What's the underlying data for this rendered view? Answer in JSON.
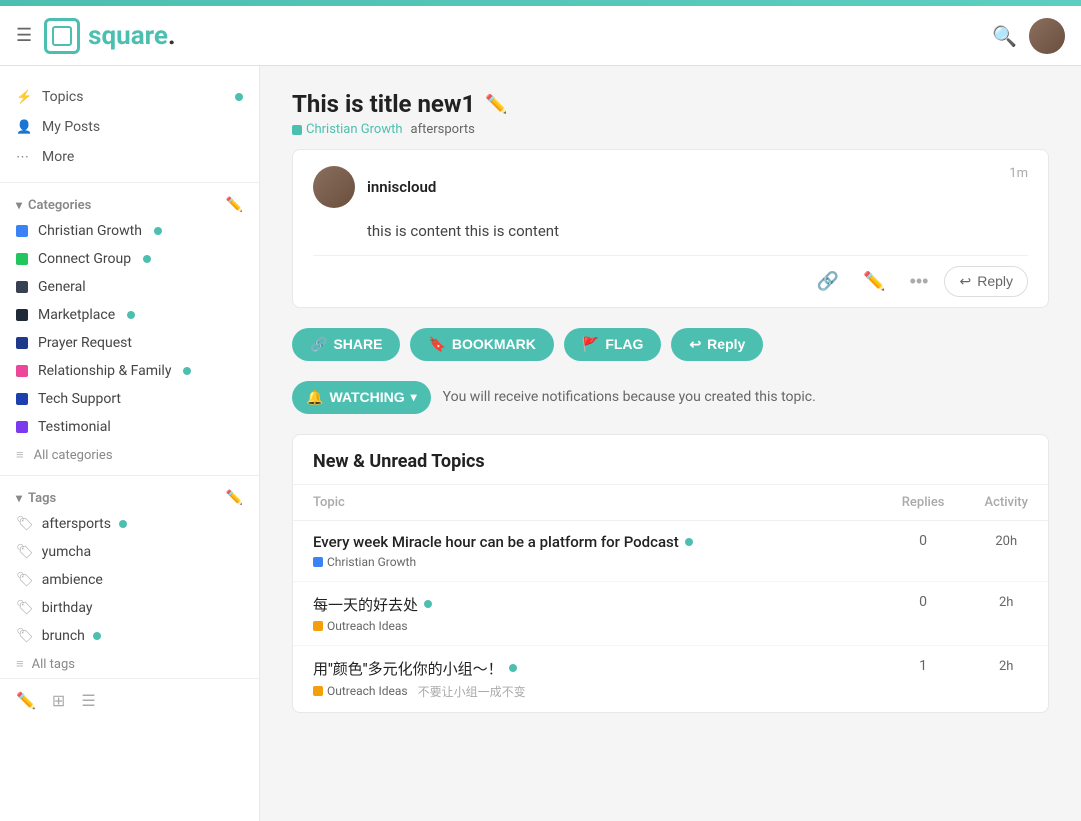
{
  "header": {
    "logo_text": "square",
    "logo_dot": "."
  },
  "sidebar": {
    "nav_items": [
      {
        "label": "Topics",
        "icon": "⋮⋮",
        "has_dot": true
      },
      {
        "label": "My Posts",
        "icon": "👤",
        "has_dot": false
      },
      {
        "label": "More",
        "icon": "⋮⋮⋮",
        "has_dot": false
      }
    ],
    "categories_label": "Categories",
    "categories": [
      {
        "label": "Christian Growth",
        "color": "#3b82f6",
        "has_badge": true
      },
      {
        "label": "Connect Group",
        "color": "#22c55e",
        "has_badge": true
      },
      {
        "label": "General",
        "color": "#374151",
        "has_badge": false
      },
      {
        "label": "Marketplace",
        "color": "#1f2937",
        "has_badge": true
      },
      {
        "label": "Prayer Request",
        "color": "#1e3a8a",
        "has_badge": false
      },
      {
        "label": "Relationship & Family",
        "color": "#ec4899",
        "has_badge": true
      },
      {
        "label": "Tech Support",
        "color": "#1e40af",
        "has_badge": false
      },
      {
        "label": "Testimonial",
        "color": "#7c3aed",
        "has_badge": false
      }
    ],
    "all_categories_label": "All categories",
    "tags_label": "Tags",
    "tags": [
      {
        "label": "aftersports",
        "has_dot": true
      },
      {
        "label": "yumcha",
        "has_dot": false
      },
      {
        "label": "ambience",
        "has_dot": false
      },
      {
        "label": "birthday",
        "has_dot": false
      },
      {
        "label": "brunch",
        "has_dot": true
      }
    ],
    "all_tags_label": "All tags"
  },
  "post": {
    "title": "This is title new1",
    "category": "Christian Growth",
    "tag": "aftersports",
    "author": "inniscloud",
    "time": "1m",
    "content": "this is content this is content",
    "reply_label": "Reply"
  },
  "action_bar": {
    "share_label": "SHARE",
    "bookmark_label": "BOOKMARK",
    "flag_label": "FLAG",
    "reply_label": "Reply",
    "watching_label": "WATCHING",
    "watching_notice": "You will receive notifications because you created this topic."
  },
  "unread_section": {
    "title": "New & Unread Topics",
    "col_topic": "Topic",
    "col_replies": "Replies",
    "col_activity": "Activity",
    "topics": [
      {
        "title": "Every week Miracle hour can be a platform for Podcast",
        "category": "Christian Growth",
        "category_color": "#3b82f6",
        "has_dot": true,
        "replies": 0,
        "activity": "20h",
        "tags": []
      },
      {
        "title": "每一天的好去处",
        "category": "Outreach Ideas",
        "category_color": "#f59e0b",
        "has_dot": true,
        "replies": 0,
        "activity": "2h",
        "tags": []
      },
      {
        "title": "用\"颜色\"多元化你的小组～！",
        "category": "Outreach Ideas",
        "category_color": "#f59e0b",
        "has_dot": true,
        "replies": 1,
        "activity": "2h",
        "tags": [
          "不要让小组一成不变"
        ]
      }
    ]
  }
}
